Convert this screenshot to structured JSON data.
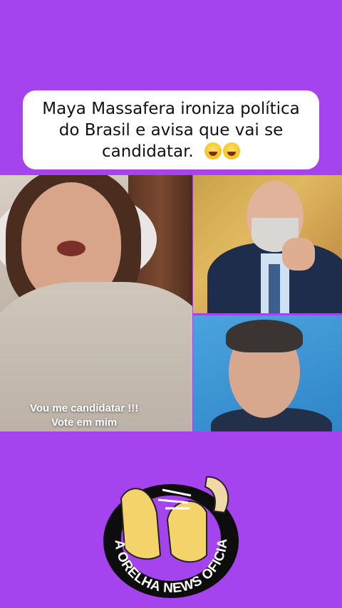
{
  "post": {
    "headline_line1": "Maya Massafera ironiza política",
    "headline_line2": "do Brasil e avisa que vai se",
    "headline_line3": "candidatar.",
    "headline_emoji": "😂😂"
  },
  "video": {
    "caption_line1": "Vou me candidatar !!!",
    "caption_line2": "Vote em mim"
  },
  "brand": {
    "logo_text": "NA ORELHA NEWS OFICIAL"
  },
  "colors": {
    "background": "#a543ef",
    "card": "#ffffff",
    "logo_ring": "#0d0d0d",
    "logo_text": "#ffffff"
  }
}
